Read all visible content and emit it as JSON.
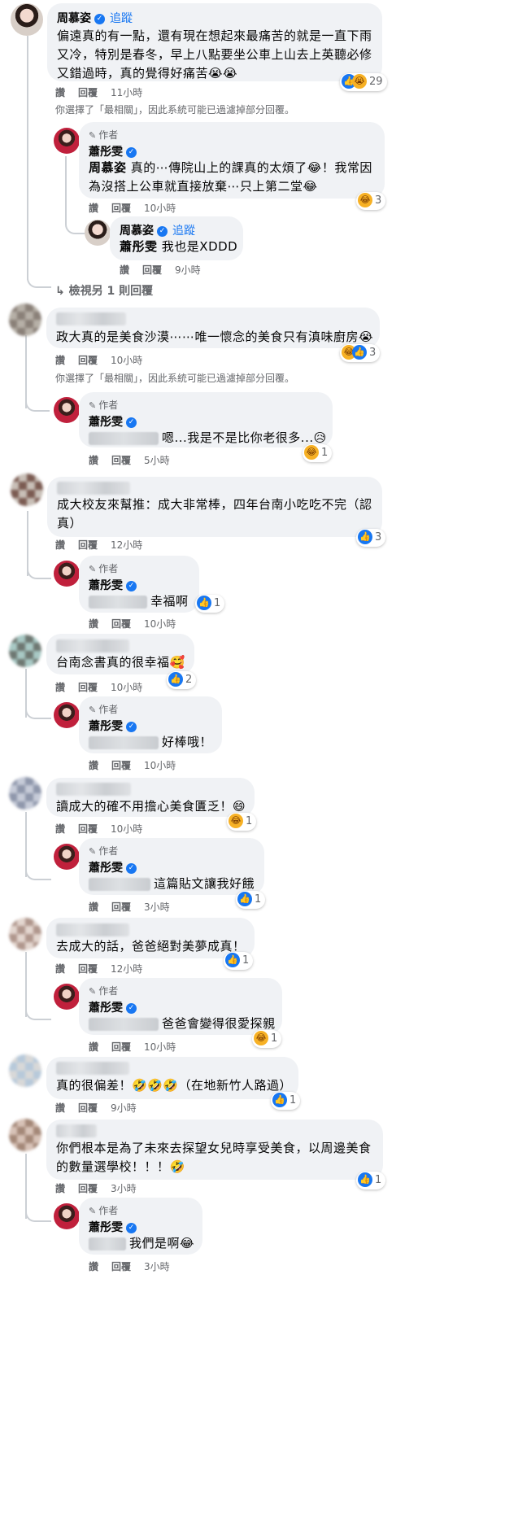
{
  "labels": {
    "like": "讚",
    "reply": "回覆",
    "author": "作者",
    "follow": "追蹤",
    "most_relevant_note": "你選擇了「最相關」，因此系統可能已過濾掉部分回覆。"
  },
  "thread1": {
    "comment": {
      "name": "周慕姿",
      "text": "偏遠真的有一點，還有現在想起來最痛苦的就是一直下雨又冷，特別是春冬，早上八點要坐公車上山去上英聽必修又錯過時，真的覺得好痛苦😭😭",
      "time": "11小時",
      "reactions": "29"
    },
    "reply1": {
      "name": "蕭彤雯",
      "mention": "周慕姿",
      "text": "真的⋯傳院山上的課真的太煩了😂！我常因為沒搭上公車就直接放棄⋯只上第二堂😂",
      "time": "10小時",
      "reactions": "3"
    },
    "reply2": {
      "name": "周慕姿",
      "mention": "蕭彤雯",
      "text": "我也是XDDD",
      "time": "9小時"
    },
    "view_more": "檢視另 1 則回覆"
  },
  "thread2": {
    "comment": {
      "text": "政大真的是美食沙漠⋯⋯唯一懷念的美食只有滇味廚房😭",
      "time": "10小時",
      "reactions": "3"
    },
    "reply": {
      "name": "蕭彤雯",
      "text": "嗯...我是不是比你老很多...😥",
      "time": "5小時",
      "reactions": "1"
    }
  },
  "thread3": {
    "comment": {
      "text": "成大校友來幫推：成大非常棒，四年台南小吃吃不完（認真）",
      "time": "12小時",
      "reactions": "3"
    },
    "reply": {
      "name": "蕭彤雯",
      "text": "幸福啊",
      "time": "10小時",
      "reactions": "1"
    }
  },
  "thread4": {
    "comment": {
      "text": "台南念書真的很幸福🥰",
      "time": "10小時",
      "reactions": "2"
    },
    "reply": {
      "name": "蕭彤雯",
      "text": "好棒哦！",
      "time": "10小時"
    }
  },
  "thread5": {
    "comment": {
      "text": "讀成大的確不用擔心美食匱乏！😄",
      "time": "10小時",
      "reactions": "1"
    },
    "reply": {
      "name": "蕭彤雯",
      "text": "這篇貼文讓我好餓",
      "time": "3小時",
      "reactions": "1"
    }
  },
  "thread6": {
    "comment": {
      "text": "去成大的話，爸爸絕對美夢成真！",
      "time": "12小時",
      "reactions": "1"
    },
    "reply": {
      "name": "蕭彤雯",
      "text": "爸爸會變得很愛探親",
      "time": "10小時",
      "reactions": "1"
    }
  },
  "thread7": {
    "comment": {
      "text": "真的很偏差！🤣🤣🤣（在地新竹人路過）",
      "time": "9小時",
      "reactions": "1"
    }
  },
  "thread8": {
    "comment": {
      "text": "你們根本是為了未來去探望女兒時享受美食，以周邊美食的數量選學校！！！🤣",
      "time": "3小時",
      "reactions": "1"
    },
    "reply": {
      "name": "蕭彤雯",
      "text": "我們是啊😂",
      "time": "3小時"
    }
  },
  "colors": {
    "bubble": "#f0f2f5",
    "link": "#1877f2",
    "meta": "#65676b"
  }
}
